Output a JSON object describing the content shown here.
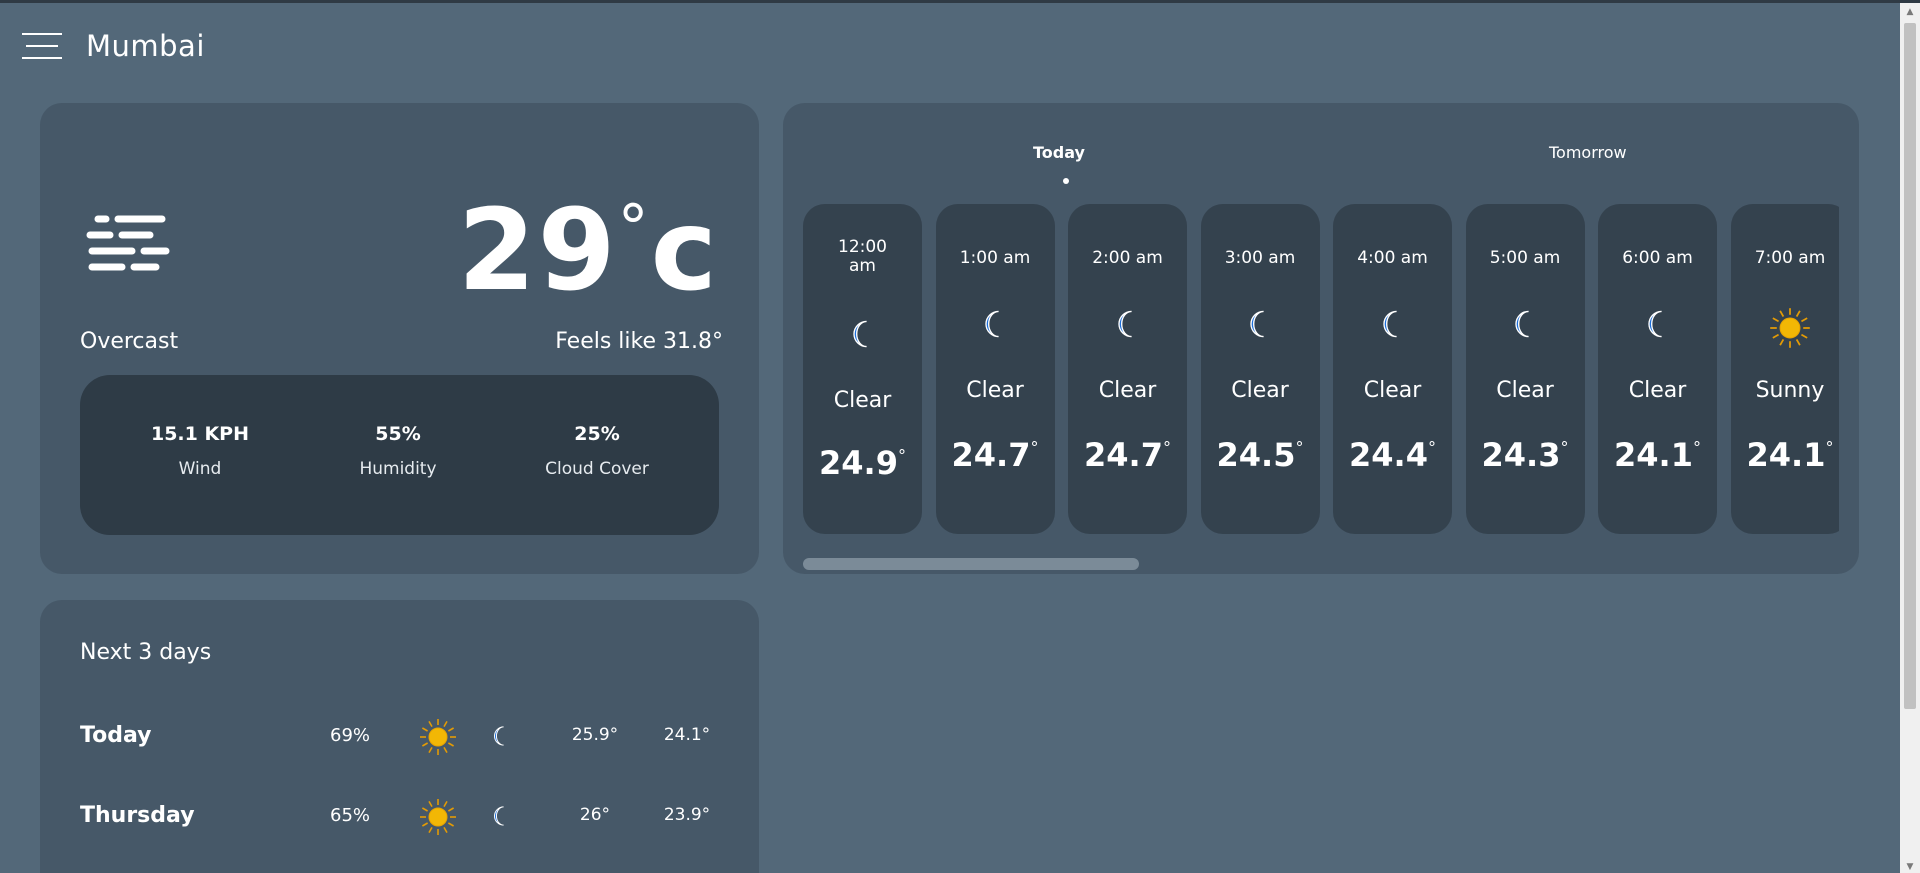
{
  "header": {
    "city": "Mumbai"
  },
  "current": {
    "temp": "29",
    "degree_symbol": "°",
    "unit": "c",
    "condition": "Overcast",
    "feels_like": "Feels like 31.8°",
    "icon": "wind-icon",
    "stats": {
      "wind_value": "15.1 KPH",
      "wind_label": "Wind",
      "humidity_value": "55%",
      "humidity_label": "Humidity",
      "cloud_value": "25%",
      "cloud_label": "Cloud Cover"
    }
  },
  "hourly": {
    "tabs": {
      "today": "Today",
      "tomorrow": "Tomorrow"
    },
    "hours": [
      {
        "time": "12:00 am",
        "icon": "moon-icon",
        "desc": "Clear",
        "temp": "24.9"
      },
      {
        "time": "1:00 am",
        "icon": "moon-icon",
        "desc": "Clear",
        "temp": "24.7"
      },
      {
        "time": "2:00 am",
        "icon": "moon-icon",
        "desc": "Clear",
        "temp": "24.7"
      },
      {
        "time": "3:00 am",
        "icon": "moon-icon",
        "desc": "Clear",
        "temp": "24.5"
      },
      {
        "time": "4:00 am",
        "icon": "moon-icon",
        "desc": "Clear",
        "temp": "24.4"
      },
      {
        "time": "5:00 am",
        "icon": "moon-icon",
        "desc": "Clear",
        "temp": "24.3"
      },
      {
        "time": "6:00 am",
        "icon": "moon-icon",
        "desc": "Clear",
        "temp": "24.1"
      },
      {
        "time": "7:00 am",
        "icon": "sun-icon",
        "desc": "Sunny",
        "temp": "24.1"
      }
    ]
  },
  "forecast": {
    "title": "Next 3 days",
    "days": [
      {
        "name": "Today",
        "chance": "69%",
        "hi": "25.9°",
        "lo": "24.1°"
      },
      {
        "name": "Thursday",
        "chance": "65%",
        "hi": "26°",
        "lo": "23.9°"
      }
    ]
  },
  "colors": {
    "background": "#536879",
    "card": "#465868",
    "inner_card": "#2e3b46",
    "moon": "#1e6fd9",
    "sun": "#f2b705"
  }
}
